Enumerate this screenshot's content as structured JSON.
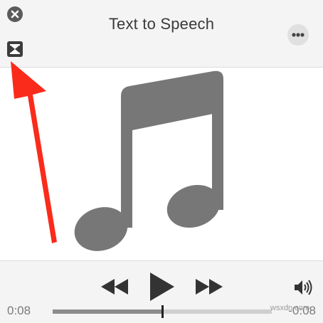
{
  "window": {
    "title": "Text to Speech"
  },
  "titlebar": {
    "close_icon": "close-icon",
    "more_icon": "ellipsis-icon",
    "collapse_icon": "hourglass-collapse-icon"
  },
  "artwork": {
    "icon": "music-note-icon",
    "color": "#777777"
  },
  "annotation": {
    "icon": "red-arrow",
    "color": "#fb2b1b"
  },
  "controls": {
    "rewind_icon": "rewind-icon",
    "play_icon": "play-icon",
    "fast_forward_icon": "fast-forward-icon",
    "volume_icon": "speaker-volume-icon",
    "elapsed": "0:08",
    "remaining": "-0:08",
    "progress": 0.5
  },
  "watermark": {
    "text": "wsxdn.com"
  }
}
